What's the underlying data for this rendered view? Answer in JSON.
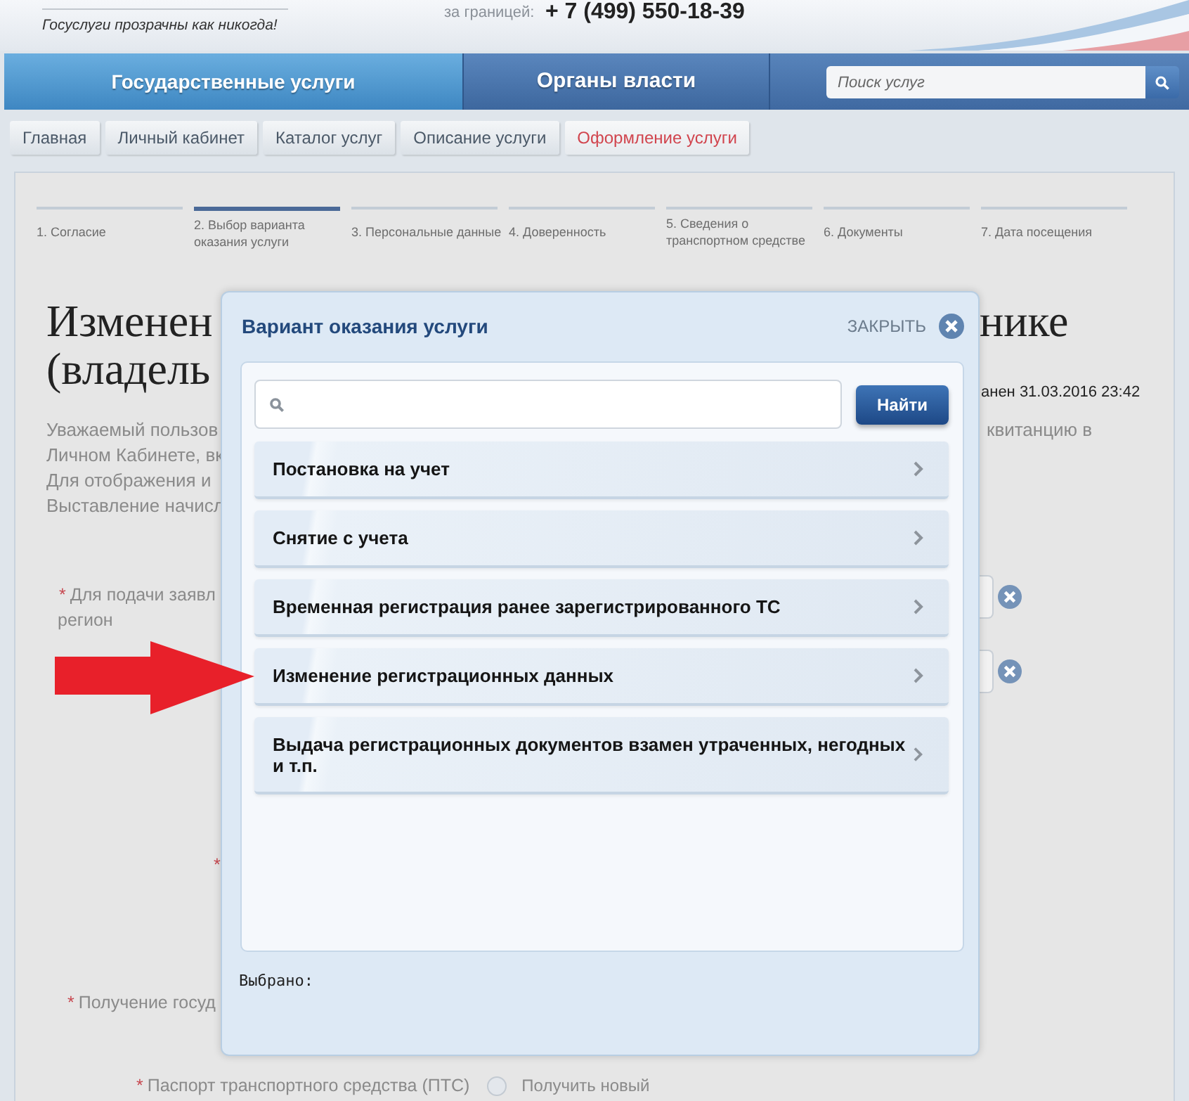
{
  "header": {
    "tagline": "Госуслуги прозрачны как никогда!",
    "phone_label": "за границей:",
    "phone": "+ 7 (499) 550-18-39"
  },
  "nav": {
    "tabs": [
      {
        "label": "Государственные услуги",
        "selected": true
      },
      {
        "label": "Органы власти",
        "selected": false
      }
    ],
    "search": {
      "placeholder": "Поиск услуг"
    }
  },
  "breadcrumbs": [
    {
      "label": "Главная",
      "selected": false
    },
    {
      "label": "Личный кабинет",
      "selected": false
    },
    {
      "label": "Каталог услуг",
      "selected": false
    },
    {
      "label": "Описание услуги",
      "selected": false
    },
    {
      "label": "Оформление услуги",
      "selected": true
    }
  ],
  "steps": [
    {
      "label": "1. Согласие",
      "selected": false
    },
    {
      "label": "2. Выбор варианта оказания услуги",
      "selected": true
    },
    {
      "label": "3. Персональные данные",
      "selected": false
    },
    {
      "label": "4. Доверенность",
      "selected": false
    },
    {
      "label": "5. Сведения о транспортном средстве",
      "selected": false
    },
    {
      "label": "6. Документы",
      "selected": false
    },
    {
      "label": "7. Дата посещения",
      "selected": false
    }
  ],
  "page_left": {
    "title_lines": [
      "Изменен",
      "(владель"
    ],
    "intro_lines": [
      "Уважаемый пользов",
      "Личном Кабинете, вк",
      "Для отображения и",
      "Выставление начисл"
    ],
    "fields": [
      {
        "required_mark": "*",
        "label_lines": [
          "Для подачи заявл",
          "регион"
        ]
      },
      {
        "required_mark": "*"
      },
      {
        "required_mark": "*",
        "label_lines": [
          "Получение госуд"
        ]
      },
      {
        "required_mark": "*",
        "label_lines": [
          "Паспорт транспортного средства (ПТС)"
        ],
        "options": [
          {
            "label": "Получить новый",
            "selected": false
          }
        ]
      }
    ]
  },
  "page_right": {
    "title": "нике",
    "saved_note": "анен 31.03.2016 23:42",
    "intro": "квитанцию в",
    "inputs": [
      {
        "clear_button": true
      },
      {
        "clear_button": true
      }
    ]
  },
  "modal": {
    "title": "Вариант оказания услуги",
    "close_label": "ЗАКРЫТЬ",
    "search_button": "Найти",
    "options": [
      {
        "label": "Постановка на учет"
      },
      {
        "label": "Снятие с учета"
      },
      {
        "label": "Временная регистрация ранее зарегистрированного ТС"
      },
      {
        "label": "Изменение регистрационных данных"
      },
      {
        "label": "Выдача регистрационных документов взамен утраченных, негодных и т.п."
      }
    ],
    "selected_label": "Выбрано:"
  }
}
